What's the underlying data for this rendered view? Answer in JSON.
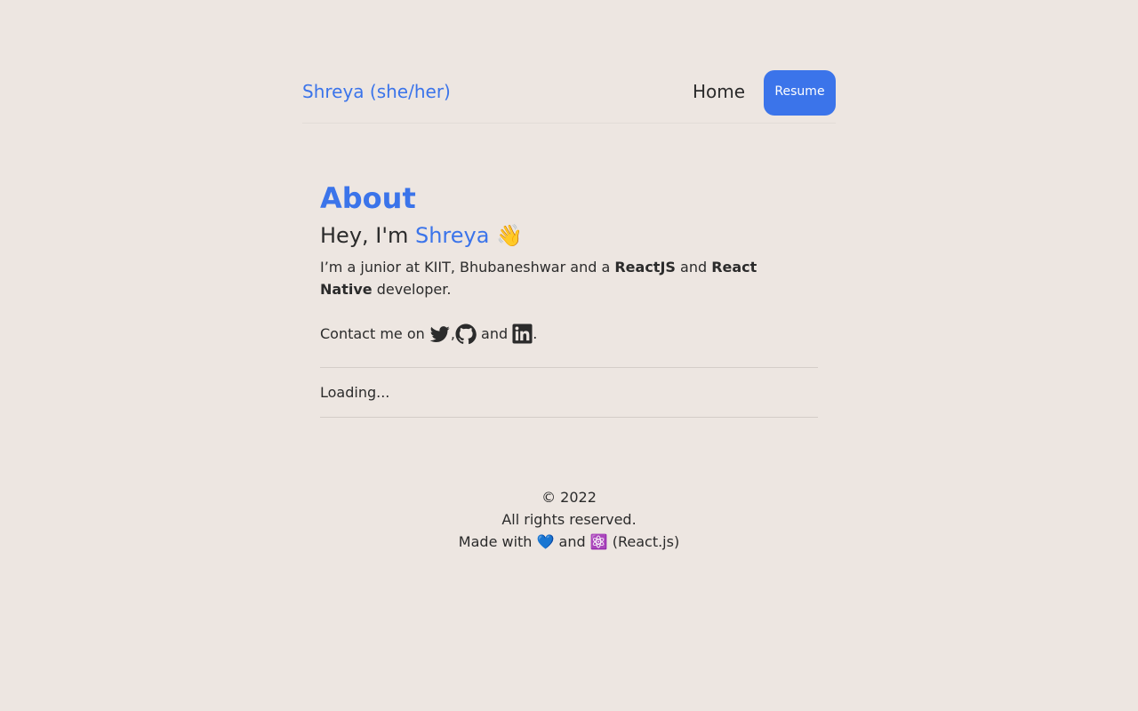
{
  "nav": {
    "brand": "Shreya (she/her)",
    "home_label": "Home",
    "resume_label": "Resume"
  },
  "about": {
    "heading": "About",
    "greeting_prefix": "Hey, I'm ",
    "greeting_name": "Shreya",
    "greeting_emoji": "👋",
    "bio_part1": "I’m a junior at KIIT, Bhubaneshwar and a ",
    "bio_bold1": "ReactJS",
    "bio_part2": " and ",
    "bio_bold2": "React Native",
    "bio_part3": " developer.",
    "contact_prefix": "Contact me on ",
    "contact_comma": ",",
    "contact_and": " and ",
    "contact_period": ".",
    "icons": [
      "twitter-icon",
      "github-icon",
      "linkedin-icon"
    ]
  },
  "status": {
    "loading_text": "Loading..."
  },
  "footer": {
    "copyright": "© 2022",
    "rights": "All rights reserved.",
    "made_with": "Made with 💙 and ⚛️ (React.js)"
  },
  "colors": {
    "background": "#ede6e1",
    "accent": "#3b74ea",
    "text": "#2b2b2b"
  }
}
